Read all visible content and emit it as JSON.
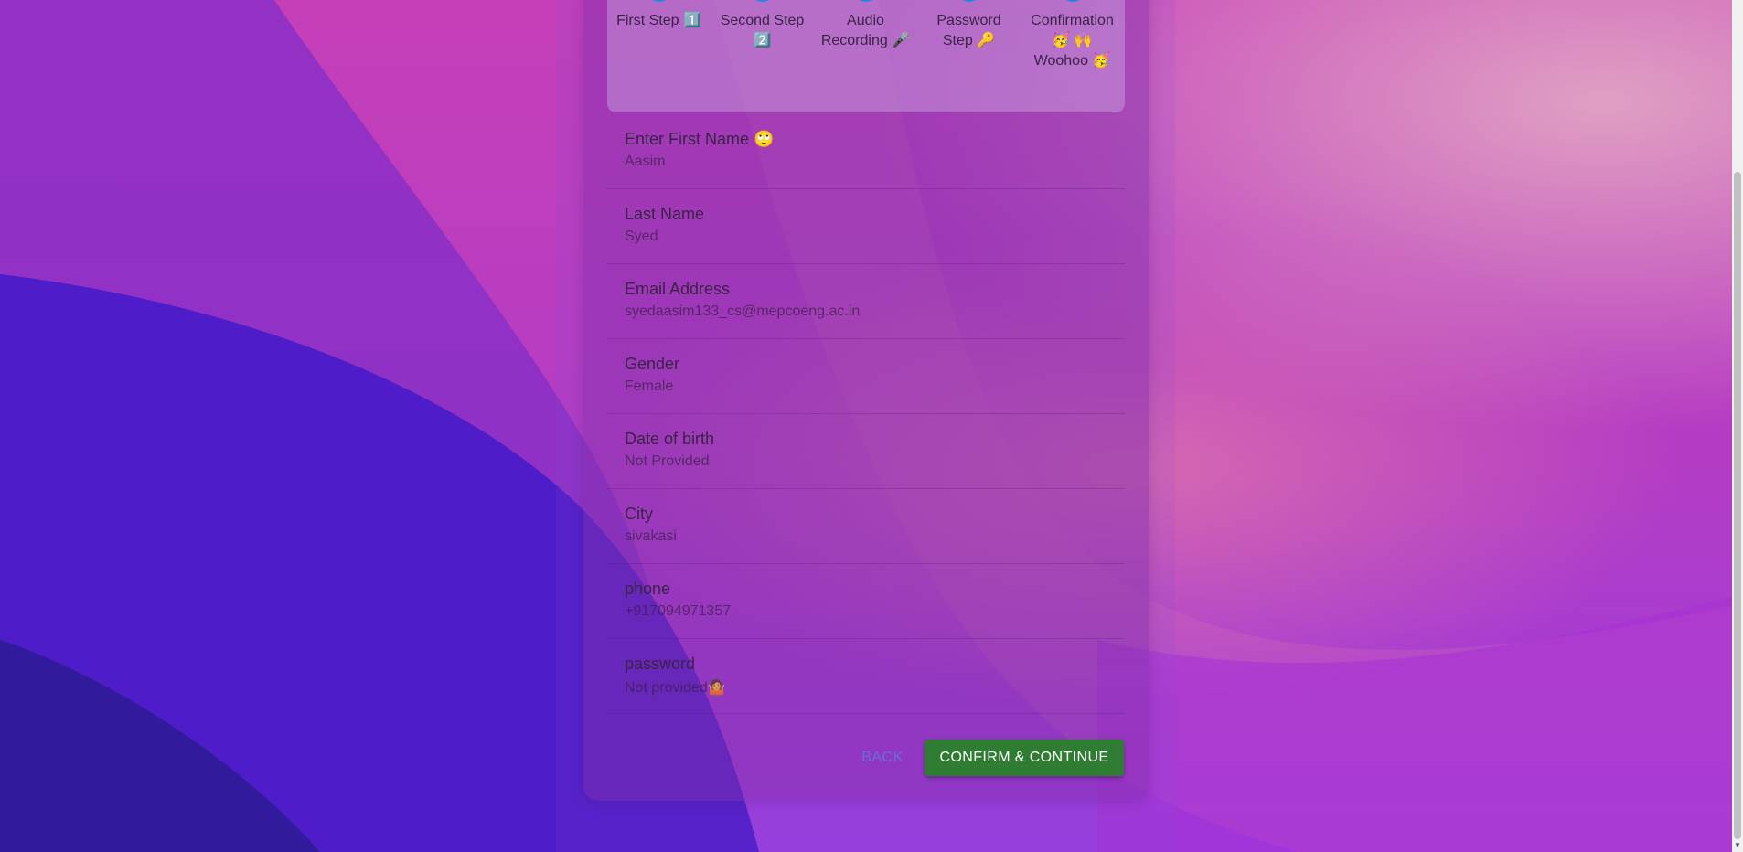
{
  "stepper": {
    "steps": [
      {
        "label": "First Step 1️⃣",
        "icon": "check-icon"
      },
      {
        "label": "Second Step 2️⃣",
        "icon": "check-icon"
      },
      {
        "label": "Audio Recording 🎤",
        "icon": "check-icon"
      },
      {
        "label": "Password Step 🔑",
        "icon": "check-icon"
      },
      {
        "label": "Confirmation 🥳 🙌 Woohoo 🥳",
        "icon": "step-number-icon"
      }
    ]
  },
  "fields": [
    {
      "label": "Enter First Name 🙄",
      "value": "Aasim"
    },
    {
      "label": "Last Name",
      "value": "Syed"
    },
    {
      "label": "Email Address",
      "value": "syedaasim133_cs@mepcoeng.ac.in"
    },
    {
      "label": "Gender",
      "value": "Female"
    },
    {
      "label": "Date of birth",
      "value": "Not Provided"
    },
    {
      "label": "City",
      "value": "sivakasi"
    },
    {
      "label": "phone",
      "value": "+917094971357"
    },
    {
      "label": "password",
      "value": "Not provided🤷"
    }
  ],
  "actions": {
    "back_label": "BACK",
    "confirm_label": "CONFIRM & CONTINUE"
  },
  "colors": {
    "primary": "#1e88e5",
    "confirm": "#2e7d32"
  }
}
